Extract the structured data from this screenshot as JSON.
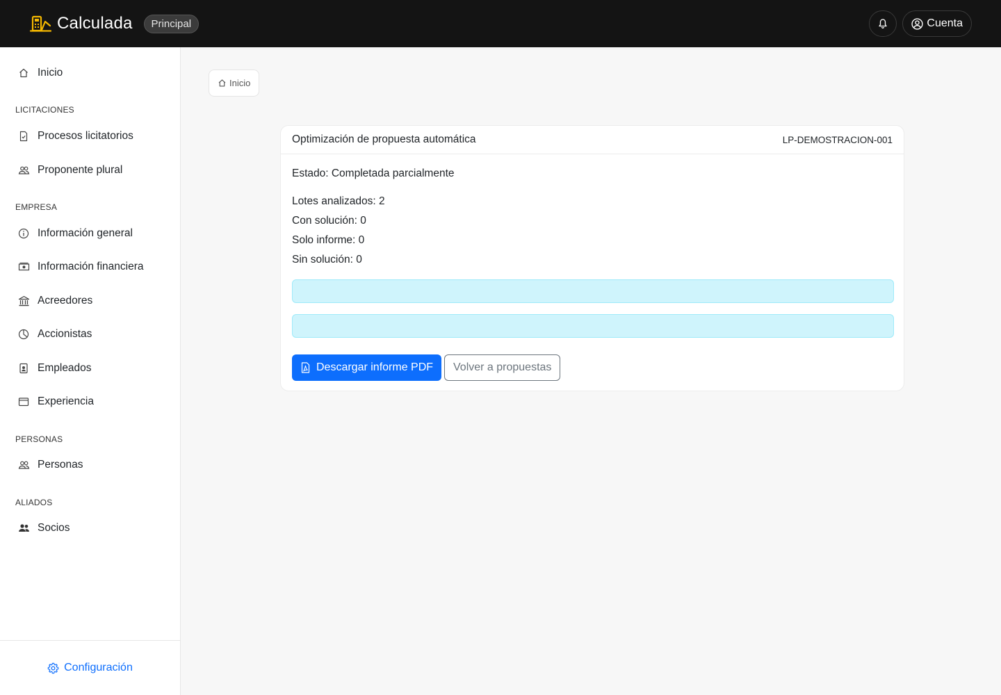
{
  "header": {
    "brand_name": "Calculada",
    "env_badge": "Principal",
    "account_label": "Cuenta",
    "brand_color": "#f5b800"
  },
  "sidebar": {
    "home": "Inicio",
    "sections": {
      "licitaciones": "LICITACIONES",
      "empresa": "EMPRESA",
      "personas": "PERSONAS",
      "aliados": "ALIADOS"
    },
    "items": {
      "procesos": "Procesos licitatorios",
      "proponente": "Proponente plural",
      "info_general": "Información general",
      "info_financiera": "Información financiera",
      "acreedores": "Acreedores",
      "accionistas": "Accionistas",
      "empleados": "Empleados",
      "experiencia": "Experiencia",
      "personas": "Personas",
      "socios": "Socios"
    },
    "config_label": "Configuración"
  },
  "breadcrumb": {
    "home": "Inicio"
  },
  "card": {
    "title": "Optimización de propuesta automática",
    "code": "LP-DEMOSTRACION-001",
    "status": "Estado: Completada parcialmente",
    "stats": {
      "lotes": "Lotes analizados: 2",
      "con_solucion": "Con solución: 0",
      "solo_informe": "Solo informe: 0",
      "sin_solucion": "Sin solución: 0"
    },
    "progress": [
      {
        "value": 0
      },
      {
        "value": 0
      }
    ],
    "download_label": "Descargar informe PDF",
    "back_label": "Volver a propuestas"
  },
  "colors": {
    "primary": "#0d6efd",
    "progress_track": "#cff4fc",
    "topbar": "#141414"
  }
}
